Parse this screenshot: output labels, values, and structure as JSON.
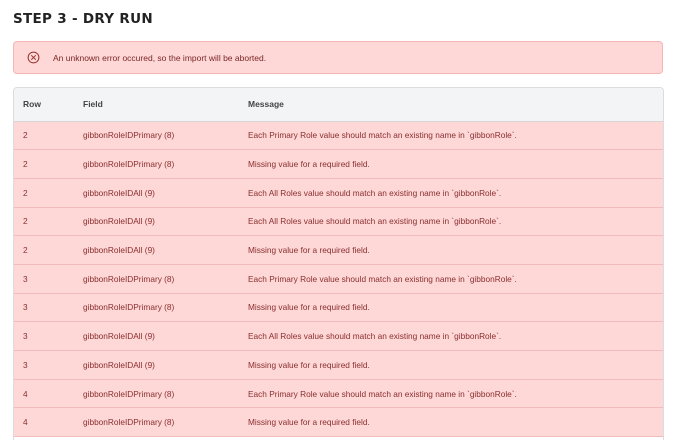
{
  "step_title": "STEP 3 - DRY RUN",
  "alert": {
    "icon": "error-circle-x-icon",
    "message": "An unknown error occured, so the import will be aborted."
  },
  "table": {
    "headers": [
      "Row",
      "Field",
      "Message"
    ],
    "rows": [
      {
        "row": "2",
        "field": "gibbonRoleIDPrimary (8)",
        "message": "Each Primary Role value should match an existing name in `gibbonRole`."
      },
      {
        "row": "2",
        "field": "gibbonRoleIDPrimary (8)",
        "message": "Missing value for a required field."
      },
      {
        "row": "2",
        "field": "gibbonRoleIDAll (9)",
        "message": "Each All Roles value should match an existing name in `gibbonRole`."
      },
      {
        "row": "2",
        "field": "gibbonRoleIDAll (9)",
        "message": "Each All Roles value should match an existing name in `gibbonRole`."
      },
      {
        "row": "2",
        "field": "gibbonRoleIDAll (9)",
        "message": "Missing value for a required field."
      },
      {
        "row": "3",
        "field": "gibbonRoleIDPrimary (8)",
        "message": "Each Primary Role value should match an existing name in `gibbonRole`."
      },
      {
        "row": "3",
        "field": "gibbonRoleIDPrimary (8)",
        "message": "Missing value for a required field."
      },
      {
        "row": "3",
        "field": "gibbonRoleIDAll (9)",
        "message": "Each All Roles value should match an existing name in `gibbonRole`."
      },
      {
        "row": "3",
        "field": "gibbonRoleIDAll (9)",
        "message": "Missing value for a required field."
      },
      {
        "row": "4",
        "field": "gibbonRoleIDPrimary (8)",
        "message": "Each Primary Role value should match an existing name in `gibbonRole`."
      },
      {
        "row": "4",
        "field": "gibbonRoleIDPrimary (8)",
        "message": "Missing value for a required field."
      }
    ]
  },
  "colors": {
    "error_bg": "#fed7d7",
    "error_text": "#8a2f2f",
    "header_bg": "#f3f4f6"
  }
}
